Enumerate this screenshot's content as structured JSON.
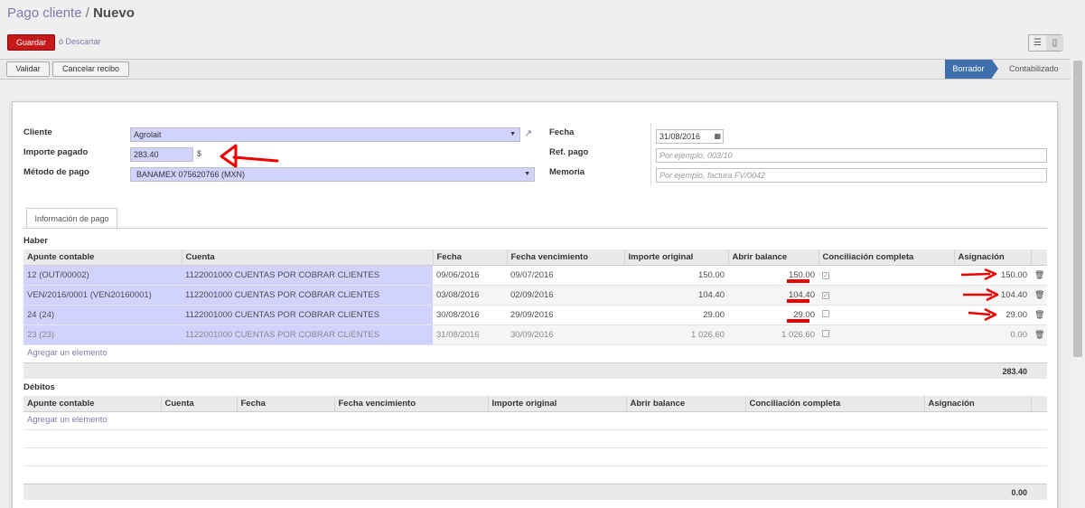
{
  "breadcrumb": {
    "parent": "Pago cliente",
    "separator": "/",
    "current": "Nuevo"
  },
  "actions": {
    "save": "Guardar",
    "or": "ó",
    "discard": "Descartar"
  },
  "view_switch": {
    "list_icon": "list-view-icon",
    "form_icon": "form-view-icon"
  },
  "statusbar": {
    "validate": "Validar",
    "cancel": "Cancelar recibo",
    "stages": [
      "Borrador",
      "Contabilizado"
    ],
    "active_stage": "Borrador"
  },
  "form": {
    "customer_label": "Cliente",
    "customer_value": "Agrolait",
    "amount_label": "Importe pagado",
    "amount_value": "283.40",
    "currency": "$",
    "method_label": "Método de pago",
    "method_value": "BANAMEX 075620766 (MXN)",
    "date_label": "Fecha",
    "date_value": "31/08/2016",
    "ref_label": "Ref. pago",
    "ref_placeholder": "Por ejemplo, 003/10",
    "memo_label": "Memoria",
    "memo_placeholder": "Por ejemplo, factura FV/0042"
  },
  "tab": "Información de pago",
  "credits": {
    "title": "Haber",
    "columns": [
      "Apunte contable",
      "Cuenta",
      "Fecha",
      "Fecha vencimiento",
      "Importe original",
      "Abrir balance",
      "Conciliación completa",
      "Asignación"
    ],
    "rows": [
      {
        "move": "12 (OUT/00002)",
        "account": "1122001000 CUENTAS POR COBRAR CLIENTES",
        "date": "09/06/2016",
        "due": "09/07/2016",
        "original": "150.00",
        "open": "150.00",
        "full": true,
        "amount": "150.00"
      },
      {
        "move": "VEN/2016/0001 (VEN20160001)",
        "account": "1122001000 CUENTAS POR COBRAR CLIENTES",
        "date": "03/08/2016",
        "due": "02/09/2016",
        "original": "104.40",
        "open": "104.40",
        "full": true,
        "amount": "104.40"
      },
      {
        "move": "24 (24)",
        "account": "1122001000 CUENTAS POR COBRAR CLIENTES",
        "date": "30/08/2016",
        "due": "29/09/2016",
        "original": "29.00",
        "open": "29.00",
        "full": false,
        "amount": "29.00"
      },
      {
        "move": "23 (23)",
        "account": "1122001000 CUENTAS POR COBRAR CLIENTES",
        "date": "31/08/2016",
        "due": "30/09/2016",
        "original": "1 026.60",
        "open": "1 026.60",
        "full": false,
        "amount": "0.00"
      }
    ],
    "add": "Agregar un elemento",
    "total": "283.40"
  },
  "debits": {
    "title": "Débitos",
    "columns": [
      "Apunte contable",
      "Cuenta",
      "Fecha",
      "Fecha vencimiento",
      "Importe original",
      "Abrir balance",
      "Conciliación completa",
      "Asignación"
    ],
    "add": "Agregar un elemento",
    "total": "0.00"
  },
  "colors": {
    "accent": "#7c7bad",
    "save": "#c61a1a",
    "stage": "#3f6fad",
    "required": "#d2d2ff",
    "annotation": "#e00000"
  }
}
